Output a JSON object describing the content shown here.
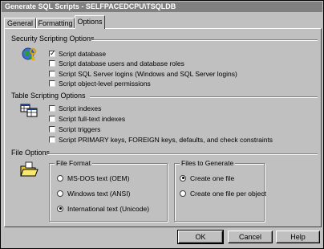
{
  "window": {
    "title": "Generate SQL Scripts - SELFPACEDCPU\\TSQLDB"
  },
  "tabs": [
    {
      "label": "General",
      "active": false
    },
    {
      "label": "Formatting",
      "active": false
    },
    {
      "label": "Options",
      "active": true
    }
  ],
  "security": {
    "title": "Security Scripting Options",
    "icon": "security-key-globe-icon",
    "items": [
      {
        "label": "Script database",
        "checked": true
      },
      {
        "label": "Script database users and database roles",
        "checked": false
      },
      {
        "label": "Script SQL Server logins (Windows and SQL Server logins)",
        "checked": false
      },
      {
        "label": "Script object-level permissions",
        "checked": false
      }
    ]
  },
  "table": {
    "title": "Table Scripting Options",
    "icon": "table-grid-icon",
    "items": [
      {
        "label": "Script indexes",
        "checked": false
      },
      {
        "label": "Script full-text indexes",
        "checked": false
      },
      {
        "label": "Script triggers",
        "checked": false
      },
      {
        "label": "Script PRIMARY keys, FOREIGN keys, defaults, and check constraints",
        "checked": false
      }
    ]
  },
  "file_options": {
    "title": "File Options",
    "icon": "folder-icon",
    "file_format": {
      "title": "File Format",
      "options": [
        {
          "label": "MS-DOS text (OEM)",
          "selected": false
        },
        {
          "label": "Windows text (ANSI)",
          "selected": false
        },
        {
          "label": "International text (Unicode)",
          "selected": true
        }
      ]
    },
    "files_to_generate": {
      "title": "Files to Generate",
      "options": [
        {
          "label": "Create one file",
          "selected": true
        },
        {
          "label": "Create one file per object",
          "selected": false
        }
      ]
    }
  },
  "buttons": {
    "ok": "OK",
    "cancel": "Cancel",
    "help": "Help"
  }
}
